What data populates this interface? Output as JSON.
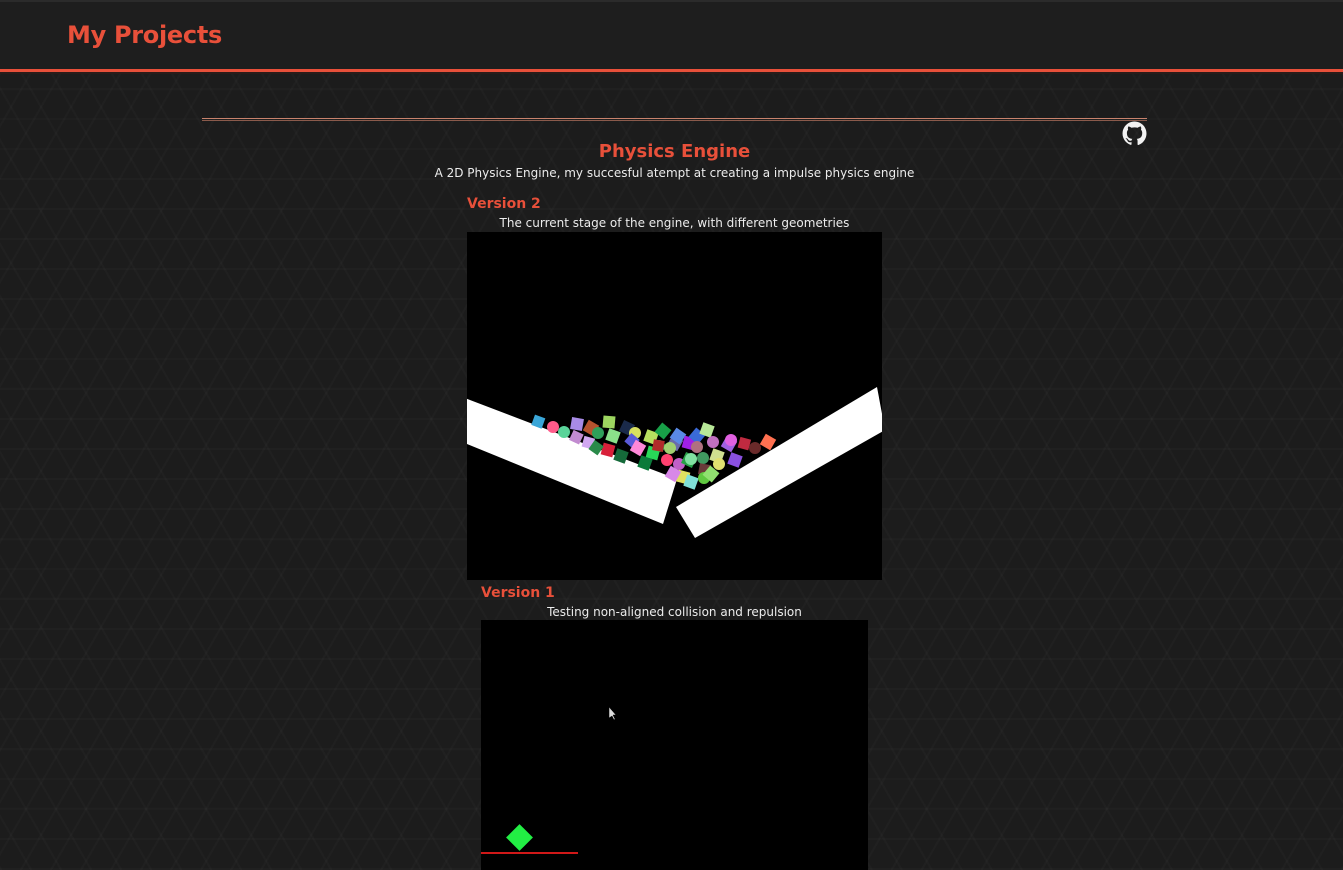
{
  "header": {
    "title": "My Projects"
  },
  "project": {
    "title": "Physics Engine",
    "description": "A 2D Physics Engine, my succesful atempt at creating a impulse physics engine",
    "repo_icon": "github-icon"
  },
  "versions": [
    {
      "title": "Version 2",
      "description": "The current stage of the engine, with different geometries"
    },
    {
      "title": "Version 1",
      "description": "Testing non-aligned collision and repulsion"
    }
  ],
  "colors": {
    "accent": "#e8503a",
    "header_bg": "#1e1e1e",
    "page_bg": "#1c1c1c",
    "text": "#ececec",
    "canvas_bg": "#000000",
    "v1_body": "#22ee44",
    "v1_floor": "#d01818"
  }
}
